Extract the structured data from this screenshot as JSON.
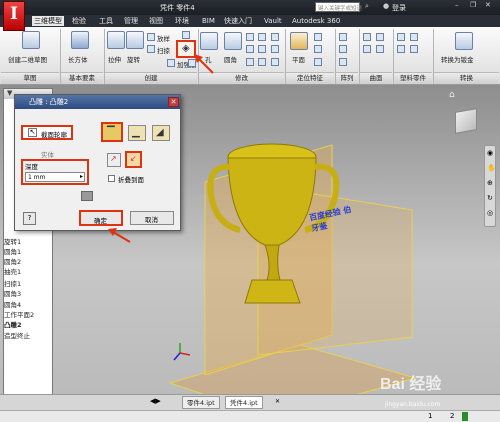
{
  "app": {
    "logo_letter": "I",
    "window_title": "凭件 零件4",
    "search_placeholder": "键入关键字或短语",
    "login": "登录"
  },
  "menus": [
    "三维模型",
    "检验",
    "工具",
    "管理",
    "视图",
    "环境",
    "BIM",
    "快速入门",
    "Vault",
    "Autodesk 360"
  ],
  "ribbon": {
    "sketch": {
      "create_sketch": "创建二维草图",
      "panel": "草图"
    },
    "primitives": {
      "box": "长方体",
      "panel": "基本要素"
    },
    "create": {
      "extrude": "拉伸",
      "revolve": "旋转",
      "loft": "放样",
      "sweep": "扫掠",
      "emboss_tool": "凸雕",
      "rib": "加强筋",
      "panel": "创建"
    },
    "modify": {
      "hole": "孔",
      "fillet": "圆角",
      "panel": "修改"
    },
    "work_features": {
      "plane": "平面",
      "panel": "定位特征"
    },
    "pattern": {
      "panel": "阵列"
    },
    "surface": {
      "panel": "曲面"
    },
    "plastic": {
      "panel": "塑料零件"
    },
    "convert": {
      "to_sheet_metal": "转换为钣金",
      "panel": "转换"
    }
  },
  "dialog": {
    "title": "凸雕 : 凸雕2",
    "profile_label": "截面轮廓",
    "solid_label": "实体",
    "depth_label": "深度",
    "depth_value": "1 mm",
    "wrap_label": "折叠到面",
    "ok": "确定",
    "cancel": "取消",
    "help": "?"
  },
  "tree": [
    {
      "label": "旋转1"
    },
    {
      "label": "圆角1"
    },
    {
      "label": "圆角2"
    },
    {
      "label": "抽壳1"
    },
    {
      "label": "扫掠1"
    },
    {
      "label": "圆角3"
    },
    {
      "label": "圆角4"
    },
    {
      "label": "工作平面2"
    },
    {
      "label": "凸雕2"
    },
    {
      "label": "造型终止"
    }
  ],
  "emboss_text": "百度经验 伯牙鉴",
  "tabs": [
    "零件4.ipt",
    "凭件4.ipt"
  ],
  "status": {
    "page1": "1",
    "page2": "2"
  },
  "watermark": {
    "text": "Bai 经验",
    "url": "jingyan.baidu.com"
  },
  "colors": {
    "ribbon_accent": "#c81e1e",
    "plane": "#e4a94a",
    "trophy": "#d8c21a"
  }
}
